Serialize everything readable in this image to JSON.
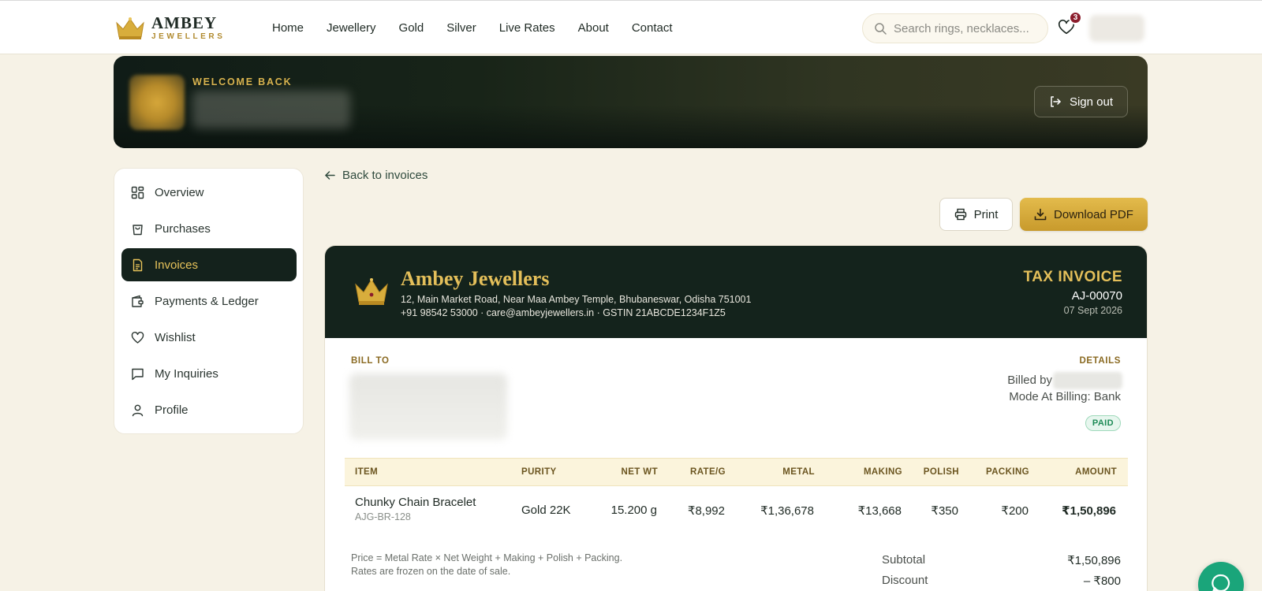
{
  "brand": {
    "name_line1": "AMBEY",
    "name_line2": "JEWELLERS",
    "crown_icon": "crown-icon",
    "accent_gold": "#e4bf5a",
    "dark_green": "#14231c"
  },
  "nav": {
    "links": [
      "Home",
      "Jewellery",
      "Gold",
      "Silver",
      "Live Rates",
      "About",
      "Contact"
    ],
    "search_placeholder": "Search rings, necklaces...",
    "wishlist_count": "3"
  },
  "banner": {
    "welcome": "WELCOME BACK",
    "sign_out": "Sign out"
  },
  "sidebar": {
    "items": [
      {
        "label": "Overview",
        "icon": "grid-icon"
      },
      {
        "label": "Purchases",
        "icon": "bag-icon"
      },
      {
        "label": "Invoices",
        "icon": "document-icon",
        "active": true
      },
      {
        "label": "Payments & Ledger",
        "icon": "wallet-icon"
      },
      {
        "label": "Wishlist",
        "icon": "heart-icon"
      },
      {
        "label": "My Inquiries",
        "icon": "message-icon"
      },
      {
        "label": "Profile",
        "icon": "user-icon"
      }
    ]
  },
  "main": {
    "back_label": "Back to invoices",
    "print_label": "Print",
    "download_label": "Download PDF"
  },
  "invoice": {
    "shop_name": "Ambey Jewellers",
    "address": "12, Main Market Road, Near Maa Ambey Temple, Bhubaneswar, Odisha 751001",
    "contact": "+91 98542 53000 · care@ambeyjewellers.in · GSTIN 21ABCDE1234F1Z5",
    "doc_title": "TAX INVOICE",
    "number": "AJ-00070",
    "date": "07 Sept 2026",
    "bill_to_label": "BILL TO",
    "details_label": "DETAILS",
    "billed_by_label": "Billed by",
    "mode": "Mode At Billing: Bank",
    "status": "PAID",
    "columns": [
      "ITEM",
      "PURITY",
      "NET WT",
      "RATE/G",
      "METAL",
      "MAKING",
      "POLISH",
      "PACKING",
      "AMOUNT"
    ],
    "rows": [
      {
        "item": "Chunky Chain Bracelet",
        "sku": "AJG-BR-128",
        "purity": "Gold 22K",
        "net_wt": "15.200 g",
        "rate": "₹8,992",
        "metal": "₹1,36,678",
        "making": "₹13,668",
        "polish": "₹350",
        "packing": "₹200",
        "amount": "₹1,50,896"
      }
    ],
    "note_line1": "Price = Metal Rate × Net Weight + Making + Polish + Packing.",
    "note_line2": "Rates are frozen on the date of sale.",
    "subtotal_label": "Subtotal",
    "subtotal": "₹1,50,896",
    "discount_label": "Discount",
    "discount": "– ₹800"
  },
  "chat": {
    "icon": "chat-icon",
    "color": "#1aa57a"
  }
}
